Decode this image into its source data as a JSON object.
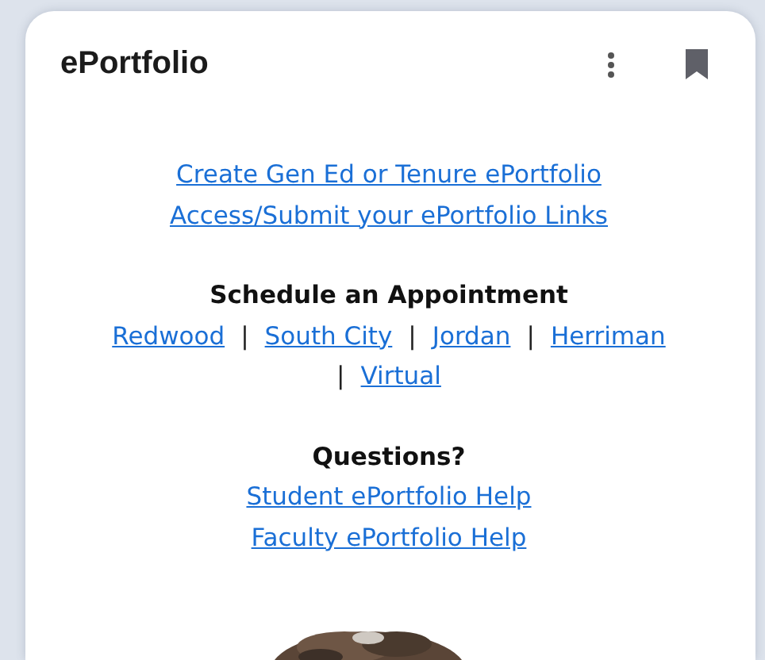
{
  "card": {
    "title": "ePortfolio"
  },
  "top_links": [
    "Create Gen Ed or Tenure ePortfolio",
    "Access/Submit your ePortfolio Links"
  ],
  "appointment": {
    "heading": "Schedule an Appointment",
    "lines": [
      [
        {
          "kind": "link",
          "text": "Redwood"
        },
        {
          "kind": "separator",
          "text": "|"
        },
        {
          "kind": "link",
          "text": "South City"
        },
        {
          "kind": "separator",
          "text": "|"
        },
        {
          "kind": "link",
          "text": "Jordan"
        },
        {
          "kind": "separator",
          "text": "|"
        },
        {
          "kind": "link",
          "text": "Herriman"
        }
      ],
      [
        {
          "kind": "separator",
          "text": "|"
        },
        {
          "kind": "link",
          "text": "Virtual"
        }
      ]
    ]
  },
  "questions": {
    "heading": "Questions?",
    "links": [
      "Student ePortfolio Help",
      "Faculty ePortfolio Help"
    ]
  }
}
